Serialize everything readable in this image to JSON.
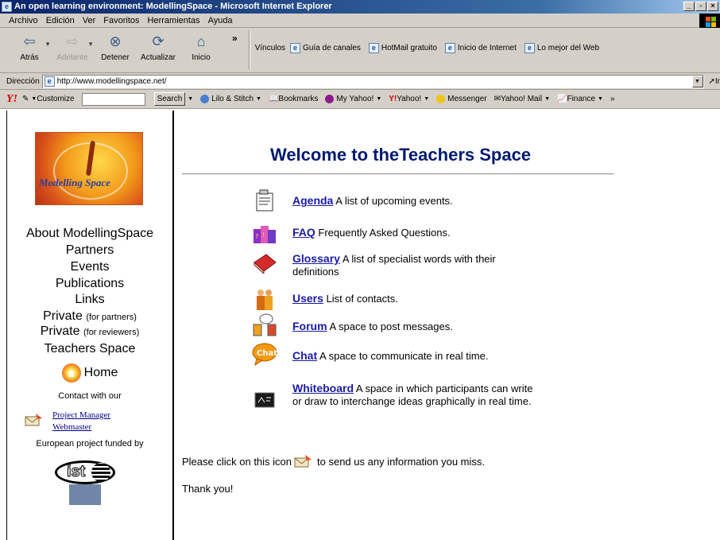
{
  "window": {
    "title": "An open learning environment: ModellingSpace - Microsoft Internet Explorer",
    "controls": [
      "_",
      "▫",
      "×"
    ]
  },
  "menu": [
    "Archivo",
    "Edición",
    "Ver",
    "Favoritos",
    "Herramientas",
    "Ayuda"
  ],
  "toolbar": {
    "back": "Atrás",
    "forward": "Adelante",
    "stop": "Detener",
    "refresh": "Actualizar",
    "home": "Inicio",
    "more": "»",
    "links_label": "Vínculos",
    "links": [
      "Guía de canales",
      "HotMail gratuito",
      "Inicio de Internet",
      "Lo mejor del Web"
    ]
  },
  "address": {
    "label": "Dirección",
    "url": "http://www.modellingspace.net/",
    "go": "Ir"
  },
  "yahoo_bar": {
    "logo": "Y!",
    "customize": "Customize",
    "search": "Search",
    "items": [
      "Lilo & Stitch",
      "Bookmarks",
      "My Yahoo!",
      "Yahoo!",
      "Messenger",
      "Yahoo! Mail",
      "Finance"
    ],
    "more": "»"
  },
  "colors": {
    "nav_link": "#1a1aa6",
    "welcome": "#001a70",
    "chrome": "#d4d0c8"
  },
  "sidebar": {
    "logo_text": "Modelling Space",
    "links": [
      {
        "label": "About ModellingSpace"
      },
      {
        "label": "Partners"
      },
      {
        "label": "Events"
      },
      {
        "label": "Publications"
      },
      {
        "label": "Links"
      },
      {
        "label": "Private",
        "note": "(for partners)"
      },
      {
        "label": "Private",
        "note": "(for reviewers)"
      },
      {
        "label": "Teachers Space"
      }
    ],
    "home": "Home",
    "contact": "Contact with our",
    "project_manager": "Project Manager",
    "webmaster": "Webmaster",
    "funded": "European project funded by",
    "ist": "ist"
  },
  "main": {
    "welcome": "Welcome to theTeachers Space",
    "items": [
      {
        "name": "Agenda",
        "desc": "A list of upcoming events.",
        "icon": "agenda-icon"
      },
      {
        "name": "FAQ",
        "desc": "Frequently Asked Questions.",
        "icon": "faq-icon"
      },
      {
        "name": "Glossary",
        "desc": "A list of specialist words with their definitions",
        "icon": "glossary-icon"
      },
      {
        "name": "Users",
        "desc": "List of contacts.",
        "icon": "users-icon"
      },
      {
        "name": "Forum",
        "desc": "A space to post messages.",
        "icon": "forum-icon"
      },
      {
        "name": "Chat",
        "desc": "A space to communicate in real time.",
        "icon": "chat-icon",
        "icon_text": "Chat"
      },
      {
        "name": "Whiteboard",
        "desc": "A space in which participants can write or draw to interchange ideas graphically in real time.",
        "icon": "whiteboard-icon"
      }
    ],
    "footer_before": "Please click on this icon",
    "footer_after": "to send us any information you miss.",
    "thanks": "Thank you!"
  }
}
